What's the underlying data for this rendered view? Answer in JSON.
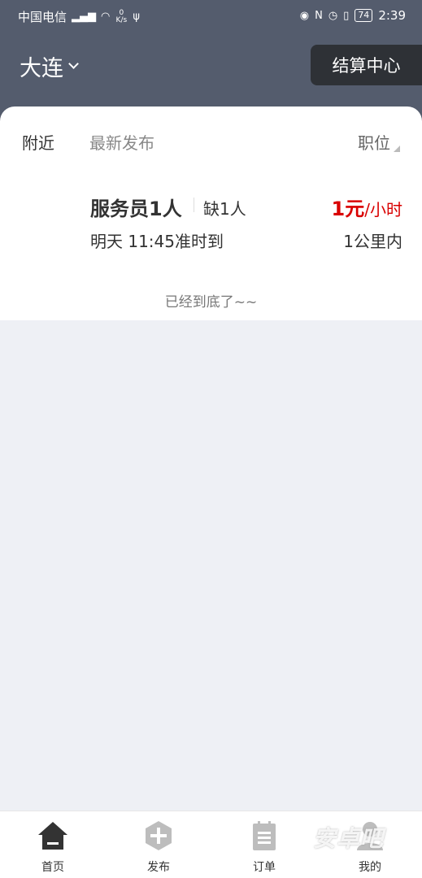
{
  "status_bar": {
    "carrier": "中国电信",
    "net_speed_value": "0",
    "net_speed_unit": "K/s",
    "battery": "74",
    "time": "2:39"
  },
  "header": {
    "city": "大连",
    "settle_button": "结算中心"
  },
  "filters": {
    "nearby": "附近",
    "latest": "最新发布",
    "position": "职位"
  },
  "job": {
    "title": "服务员1人",
    "need": "缺1人",
    "pay_amount": "1元",
    "pay_unit": "/小时",
    "time": "明天 11:45准时到",
    "distance": "1公里内"
  },
  "list_end_text": "已经到底了~~",
  "tabbar": {
    "items": [
      {
        "label": "首页",
        "icon": "home-icon"
      },
      {
        "label": "发布",
        "icon": "plus-hexagon-icon"
      },
      {
        "label": "订单",
        "icon": "order-document-icon"
      },
      {
        "label": "我的",
        "icon": "user-icon"
      }
    ]
  },
  "watermark": "安卓吧",
  "colors": {
    "header_bg": "#545c6d",
    "accent_red": "#d90000",
    "page_bg": "#eef0f5"
  }
}
